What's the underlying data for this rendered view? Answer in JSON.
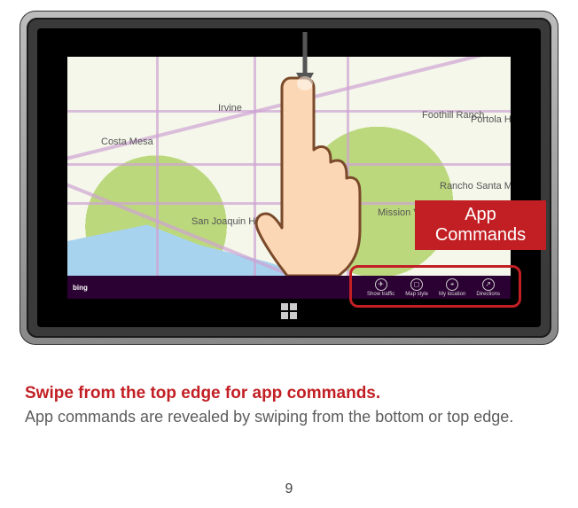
{
  "callout_label": "App\nCommands",
  "map_labels": {
    "irvine": "Irvine",
    "costa_mesa": "Costa Mesa",
    "mission_viejo": "Mission Viejo",
    "foothill_ranch": "Foothill Ranch",
    "san_joaquin": "San Joaquin Hills",
    "portola_hills": "Portola Hills",
    "rancho": "Rancho Santa Margarita"
  },
  "appbar": {
    "brand": "bing",
    "commands": [
      {
        "icon": "✈",
        "label": "Show traffic"
      },
      {
        "icon": "◻",
        "label": "Map style"
      },
      {
        "icon": "⌖",
        "label": "My location"
      },
      {
        "icon": "↗",
        "label": "Directions"
      }
    ]
  },
  "caption": {
    "heading": "Swipe from the top edge for app commands.",
    "body": "App commands are revealed by swiping from the bottom or top edge."
  },
  "page_number": "9"
}
